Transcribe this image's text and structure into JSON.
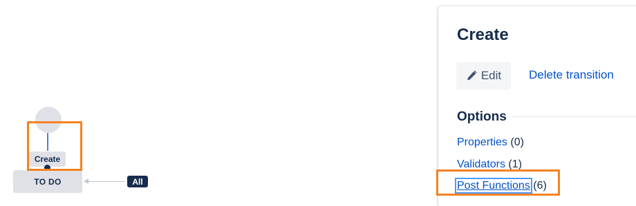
{
  "diagram": {
    "transition_label": "Create",
    "status_label": "TO DO",
    "all_badge": "All"
  },
  "panel": {
    "title": "Create",
    "edit_label": "Edit",
    "delete_label": "Delete transition",
    "options_heading": "Options",
    "options": [
      {
        "label": "Properties",
        "count": "(0)"
      },
      {
        "label": "Validators",
        "count": "(1)"
      },
      {
        "label": "Post Functions",
        "count": "(6)"
      }
    ]
  },
  "colors": {
    "highlight": "#f58220",
    "link": "#0052cc",
    "text": "#172b4d",
    "node": "#dfe1e6"
  },
  "icons": {
    "edit": "pencil-icon"
  }
}
